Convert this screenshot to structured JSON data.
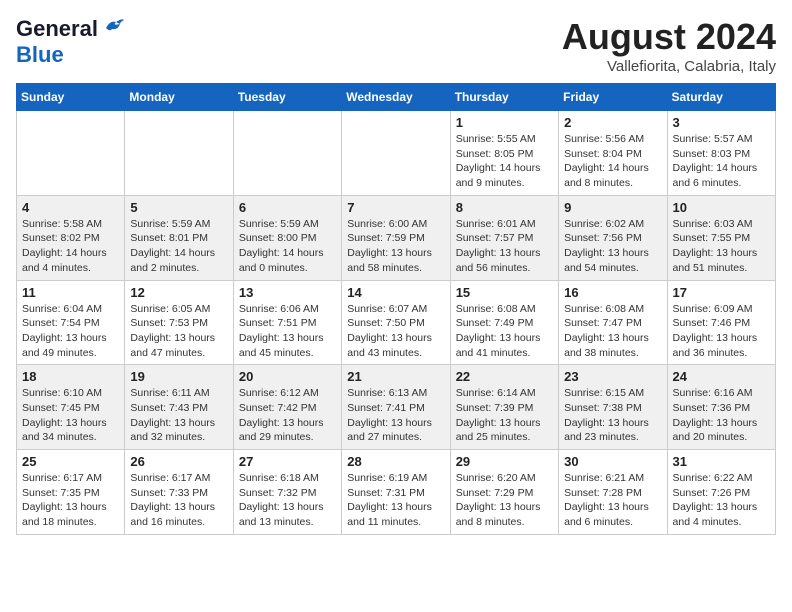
{
  "header": {
    "logo_line1": "General",
    "logo_line2": "Blue",
    "month_title": "August 2024",
    "location": "Vallefiorita, Calabria, Italy"
  },
  "weekdays": [
    "Sunday",
    "Monday",
    "Tuesday",
    "Wednesday",
    "Thursday",
    "Friday",
    "Saturday"
  ],
  "weeks": [
    [
      {
        "day": "",
        "info": ""
      },
      {
        "day": "",
        "info": ""
      },
      {
        "day": "",
        "info": ""
      },
      {
        "day": "",
        "info": ""
      },
      {
        "day": "1",
        "info": "Sunrise: 5:55 AM\nSunset: 8:05 PM\nDaylight: 14 hours\nand 9 minutes."
      },
      {
        "day": "2",
        "info": "Sunrise: 5:56 AM\nSunset: 8:04 PM\nDaylight: 14 hours\nand 8 minutes."
      },
      {
        "day": "3",
        "info": "Sunrise: 5:57 AM\nSunset: 8:03 PM\nDaylight: 14 hours\nand 6 minutes."
      }
    ],
    [
      {
        "day": "4",
        "info": "Sunrise: 5:58 AM\nSunset: 8:02 PM\nDaylight: 14 hours\nand 4 minutes."
      },
      {
        "day": "5",
        "info": "Sunrise: 5:59 AM\nSunset: 8:01 PM\nDaylight: 14 hours\nand 2 minutes."
      },
      {
        "day": "6",
        "info": "Sunrise: 5:59 AM\nSunset: 8:00 PM\nDaylight: 14 hours\nand 0 minutes."
      },
      {
        "day": "7",
        "info": "Sunrise: 6:00 AM\nSunset: 7:59 PM\nDaylight: 13 hours\nand 58 minutes."
      },
      {
        "day": "8",
        "info": "Sunrise: 6:01 AM\nSunset: 7:57 PM\nDaylight: 13 hours\nand 56 minutes."
      },
      {
        "day": "9",
        "info": "Sunrise: 6:02 AM\nSunset: 7:56 PM\nDaylight: 13 hours\nand 54 minutes."
      },
      {
        "day": "10",
        "info": "Sunrise: 6:03 AM\nSunset: 7:55 PM\nDaylight: 13 hours\nand 51 minutes."
      }
    ],
    [
      {
        "day": "11",
        "info": "Sunrise: 6:04 AM\nSunset: 7:54 PM\nDaylight: 13 hours\nand 49 minutes."
      },
      {
        "day": "12",
        "info": "Sunrise: 6:05 AM\nSunset: 7:53 PM\nDaylight: 13 hours\nand 47 minutes."
      },
      {
        "day": "13",
        "info": "Sunrise: 6:06 AM\nSunset: 7:51 PM\nDaylight: 13 hours\nand 45 minutes."
      },
      {
        "day": "14",
        "info": "Sunrise: 6:07 AM\nSunset: 7:50 PM\nDaylight: 13 hours\nand 43 minutes."
      },
      {
        "day": "15",
        "info": "Sunrise: 6:08 AM\nSunset: 7:49 PM\nDaylight: 13 hours\nand 41 minutes."
      },
      {
        "day": "16",
        "info": "Sunrise: 6:08 AM\nSunset: 7:47 PM\nDaylight: 13 hours\nand 38 minutes."
      },
      {
        "day": "17",
        "info": "Sunrise: 6:09 AM\nSunset: 7:46 PM\nDaylight: 13 hours\nand 36 minutes."
      }
    ],
    [
      {
        "day": "18",
        "info": "Sunrise: 6:10 AM\nSunset: 7:45 PM\nDaylight: 13 hours\nand 34 minutes."
      },
      {
        "day": "19",
        "info": "Sunrise: 6:11 AM\nSunset: 7:43 PM\nDaylight: 13 hours\nand 32 minutes."
      },
      {
        "day": "20",
        "info": "Sunrise: 6:12 AM\nSunset: 7:42 PM\nDaylight: 13 hours\nand 29 minutes."
      },
      {
        "day": "21",
        "info": "Sunrise: 6:13 AM\nSunset: 7:41 PM\nDaylight: 13 hours\nand 27 minutes."
      },
      {
        "day": "22",
        "info": "Sunrise: 6:14 AM\nSunset: 7:39 PM\nDaylight: 13 hours\nand 25 minutes."
      },
      {
        "day": "23",
        "info": "Sunrise: 6:15 AM\nSunset: 7:38 PM\nDaylight: 13 hours\nand 23 minutes."
      },
      {
        "day": "24",
        "info": "Sunrise: 6:16 AM\nSunset: 7:36 PM\nDaylight: 13 hours\nand 20 minutes."
      }
    ],
    [
      {
        "day": "25",
        "info": "Sunrise: 6:17 AM\nSunset: 7:35 PM\nDaylight: 13 hours\nand 18 minutes."
      },
      {
        "day": "26",
        "info": "Sunrise: 6:17 AM\nSunset: 7:33 PM\nDaylight: 13 hours\nand 16 minutes."
      },
      {
        "day": "27",
        "info": "Sunrise: 6:18 AM\nSunset: 7:32 PM\nDaylight: 13 hours\nand 13 minutes."
      },
      {
        "day": "28",
        "info": "Sunrise: 6:19 AM\nSunset: 7:31 PM\nDaylight: 13 hours\nand 11 minutes."
      },
      {
        "day": "29",
        "info": "Sunrise: 6:20 AM\nSunset: 7:29 PM\nDaylight: 13 hours\nand 8 minutes."
      },
      {
        "day": "30",
        "info": "Sunrise: 6:21 AM\nSunset: 7:28 PM\nDaylight: 13 hours\nand 6 minutes."
      },
      {
        "day": "31",
        "info": "Sunrise: 6:22 AM\nSunset: 7:26 PM\nDaylight: 13 hours\nand 4 minutes."
      }
    ]
  ]
}
